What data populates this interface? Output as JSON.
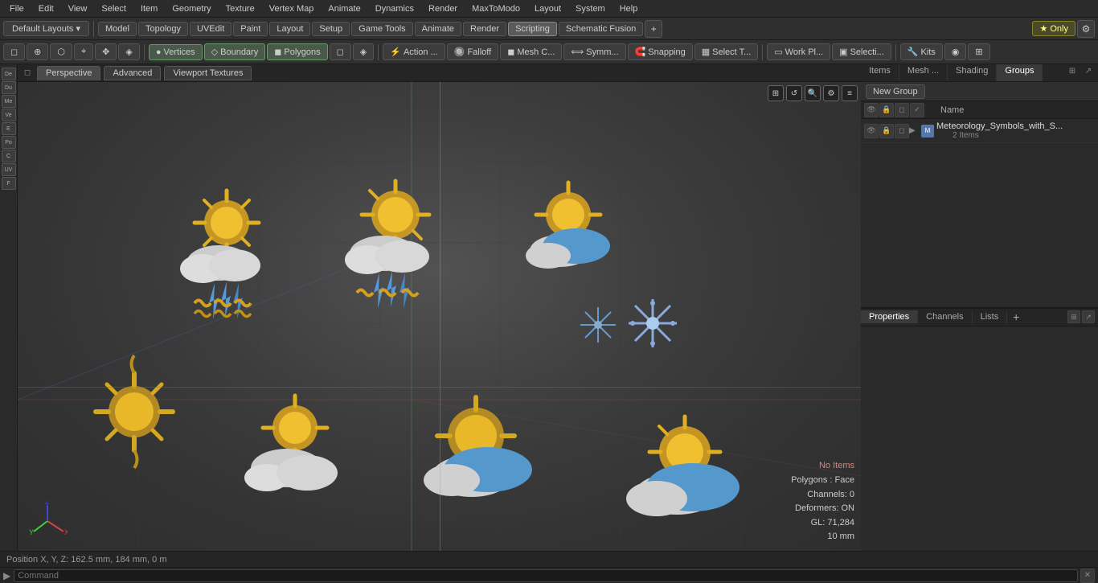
{
  "menu": {
    "items": [
      "File",
      "Edit",
      "View",
      "Select",
      "Item",
      "Geometry",
      "Texture",
      "Vertex Map",
      "Animate",
      "Dynamics",
      "Render",
      "MaxToModo",
      "Layout",
      "System",
      "Help"
    ]
  },
  "toolbar1": {
    "layouts_label": "Default Layouts ▾",
    "mode_buttons": [
      "Model",
      "Topology",
      "UVEdit",
      "Paint",
      "Layout",
      "Setup",
      "Game Tools",
      "Animate",
      "Render",
      "Scripting",
      "Schematic Fusion"
    ],
    "active_mode": "Scripting",
    "star_label": "★ Only",
    "plus_icon": "+",
    "settings_icon": "⚙"
  },
  "toolbar2": {
    "buttons": [
      "▸",
      "◻",
      "⊕",
      "⬡",
      "⌖",
      "✥",
      "◈",
      "Vertices",
      "Boundary",
      "Polygons",
      "◻",
      "◈",
      "◈",
      "Action ...",
      "Falloff",
      "Mesh C...",
      "Symm...",
      "Snapping",
      "Select T...",
      "Work Pl...",
      "Selecti...",
      "Kits",
      "◉",
      "⊞"
    ]
  },
  "viewport": {
    "tabs": [
      "Perspective",
      "Advanced",
      "Viewport Textures"
    ],
    "active_tab": "Perspective",
    "overlay_icons": [
      "⊞",
      "↺",
      "🔍",
      "⚙",
      "≡"
    ],
    "info": {
      "no_items": "No Items",
      "polygons": "Polygons : Face",
      "channels": "Channels: 0",
      "deformers": "Deformers: ON",
      "gl": "GL: 71,284",
      "mm": "10 mm"
    }
  },
  "right_panel": {
    "tabs": [
      "Items",
      "Mesh ...",
      "Shading",
      "Groups"
    ],
    "active_tab": "Groups",
    "new_group_label": "New Group",
    "name_col": "Name",
    "group_item": {
      "name": "Meteorology_Symbols_with_S...",
      "count": "2 Items"
    }
  },
  "properties_panel": {
    "tabs": [
      "Properties",
      "Channels",
      "Lists"
    ],
    "active_tab": "Properties",
    "add_label": "+"
  },
  "status_bar": {
    "text": "Position X, Y, Z:   162.5 mm, 184 mm, 0 m"
  },
  "command_bar": {
    "arrow": "▶",
    "placeholder": "Command",
    "clear_icon": "✕"
  },
  "left_sidebar": {
    "items": [
      "De",
      "Du",
      "Me",
      "Ve",
      "E",
      "Po",
      "C",
      "UV",
      "F"
    ]
  }
}
